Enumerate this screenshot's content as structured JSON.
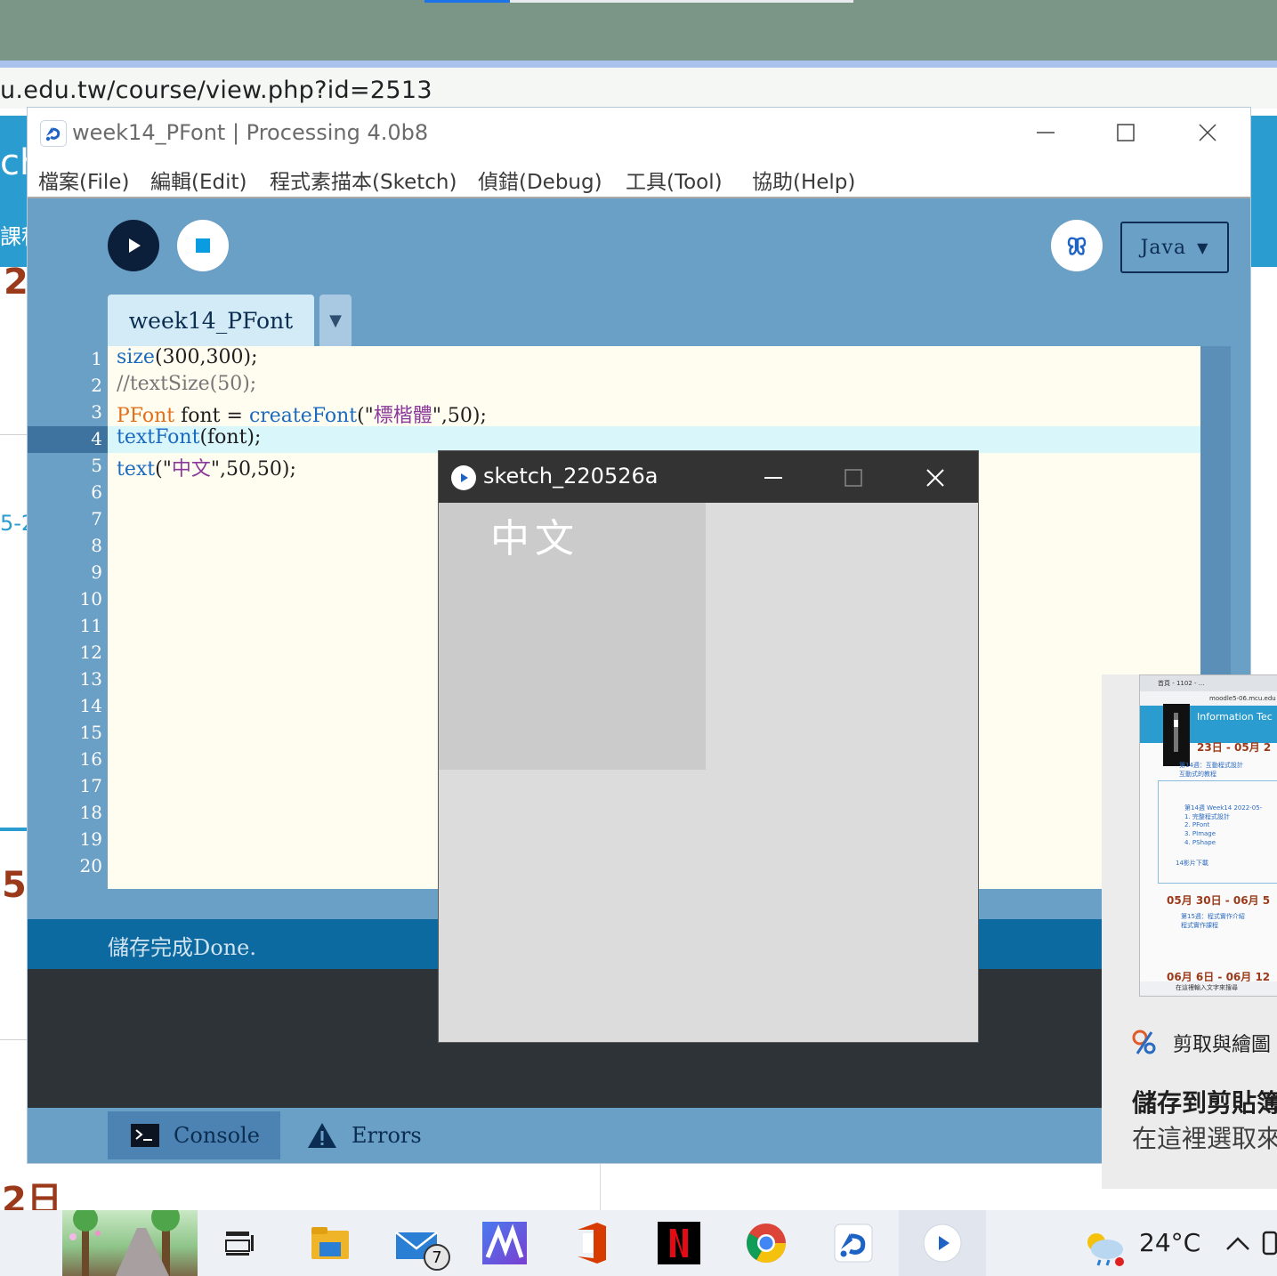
{
  "browser": {
    "address": "u.edu.tw/course/view.php?id=2513"
  },
  "page_behind": {
    "left_fragments": [
      "ch",
      "課程",
      "2",
      "5-2",
      "5",
      "2日"
    ]
  },
  "processing": {
    "window_title": "week14_PFont | Processing 4.0b8",
    "menu": [
      "檔案(File)",
      "編輯(Edit)",
      "程式素描本(Sketch)",
      "偵錯(Debug)",
      "工具(Tool)",
      "協助(Help)"
    ],
    "mode": "Java",
    "tab_name": "week14_PFont",
    "line_numbers": [
      "1",
      "2",
      "3",
      "4",
      "5",
      "6",
      "7",
      "8",
      "9",
      "10",
      "11",
      "12",
      "13",
      "14",
      "15",
      "16",
      "17",
      "18",
      "19",
      "20"
    ],
    "code": {
      "l1_fn": "size",
      "l1_rest": "(300,300);",
      "l2": "//textSize(50);",
      "l3_type": "PFont",
      "l3_mid": " font = ",
      "l3_fn": "createFont",
      "l3_open": "(\"",
      "l3_str": "標楷體",
      "l3_close": "\",50);",
      "l4_fn": "textFont",
      "l4_rest": "(font);",
      "l5_fn": "text",
      "l5_open": "(\"",
      "l5_str": "中文",
      "l5_close": "\",50,50);"
    },
    "status_message": "儲存完成Done.",
    "bottom_tabs": [
      "Console",
      "Errors"
    ]
  },
  "sketch_window": {
    "title": "sketch_220526a",
    "canvas_text": "中文"
  },
  "snip_notification": {
    "app_name": "剪取與繪圖",
    "heading": "儲存到剪貼簿",
    "subtext": "在這裡選取來",
    "thumb": {
      "tab1": "首頁 - 1102 - ...",
      "url": "moodle5-06.mcu.edu",
      "banner": "Information Tec",
      "week1": "23日 - 05月 2",
      "week1_items": [
        "第14週：互動程式設計",
        "互動式的教程"
      ],
      "week_item": "第14週 Week14 2022-05-",
      "list": [
        "1. 完整程式設計",
        "2. PFont",
        "3. PImage",
        "4. PShape"
      ],
      "video": "14影片下載",
      "week2": "05月 30日 - 06月 5",
      "week2_items": [
        "第15週：程式實作介紹",
        "程式實作課程"
      ],
      "week3": "06月 6日 - 06月 12",
      "search": "在這裡輸入文字來搜尋"
    }
  },
  "taskbar": {
    "mail_badge": "7",
    "temperature": "24°C"
  },
  "colors": {
    "pde_bg": "#6a9fc6",
    "editor_bg": "#fffdf0",
    "keyword_blue": "#1a6ac0",
    "type_orange": "#e0701a",
    "string_purple": "#8b3a9b",
    "comment_gray": "#777777",
    "status_bar": "#0d6aa0"
  }
}
